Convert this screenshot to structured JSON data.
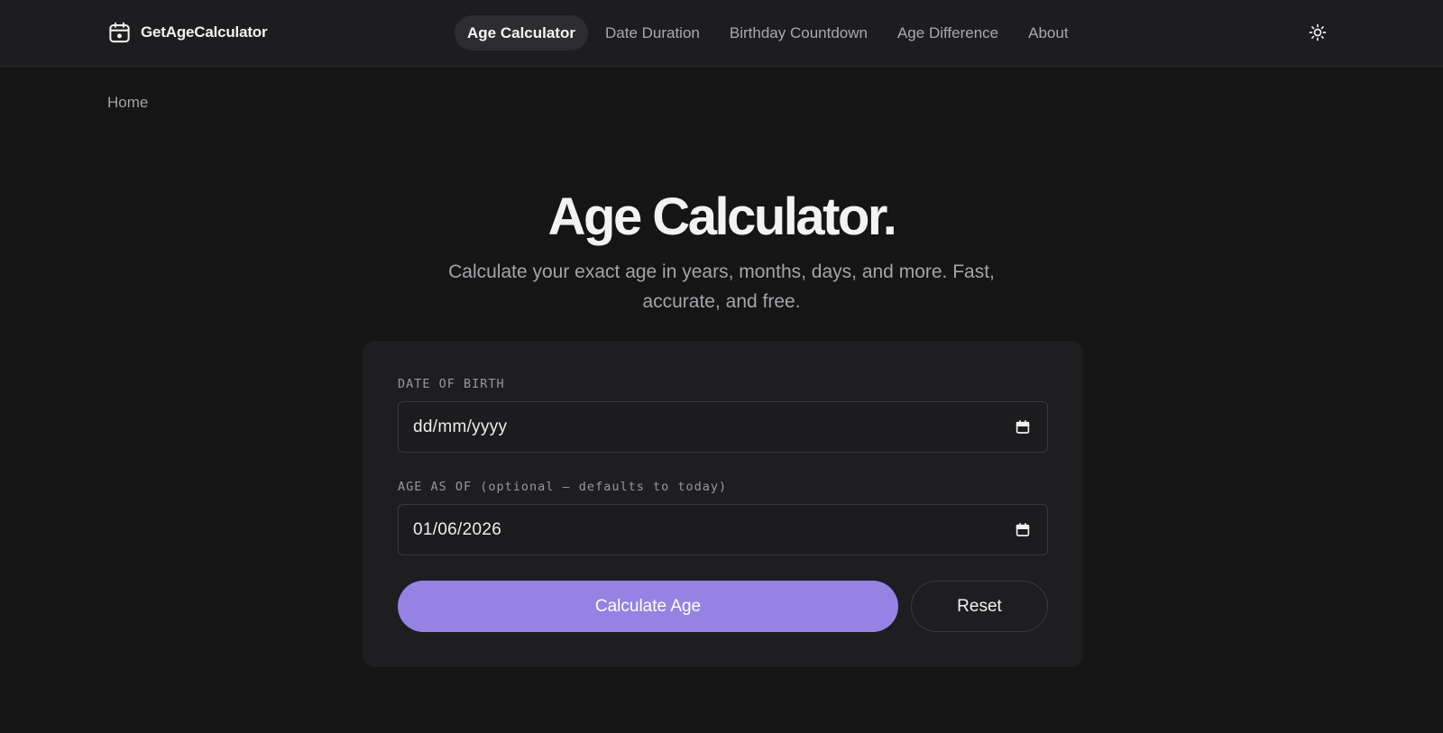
{
  "header": {
    "brand_name": "GetAgeCalculator",
    "brand_icon": "calendar-icon",
    "nav": [
      {
        "label": "Age Calculator",
        "active": true
      },
      {
        "label": "Date Duration",
        "active": false
      },
      {
        "label": "Birthday Countdown",
        "active": false
      },
      {
        "label": "Age Difference",
        "active": false
      },
      {
        "label": "About",
        "active": false
      }
    ],
    "theme_toggle_icon": "sun-icon"
  },
  "breadcrumb": {
    "home": "Home"
  },
  "hero": {
    "title": "Age Calculator.",
    "subtitle": "Calculate your exact age in years, months, days, and more. Fast, accurate, and free."
  },
  "form": {
    "dob": {
      "label": "DATE OF BIRTH",
      "value": "dd/mm/yyyy",
      "icon": "calendar-icon"
    },
    "as_of": {
      "label": "AGE AS OF (optional — defaults to today)",
      "value": "01/06/2026",
      "icon": "calendar-icon"
    },
    "calculate_label": "Calculate Age",
    "reset_label": "Reset"
  },
  "colors": {
    "background": "#151516",
    "header_bg": "#1d1d1f",
    "card_bg": "#1e1e20",
    "accent": "#9483e2",
    "text_primary": "#f3f3f3",
    "text_muted": "#a4a4a9"
  }
}
